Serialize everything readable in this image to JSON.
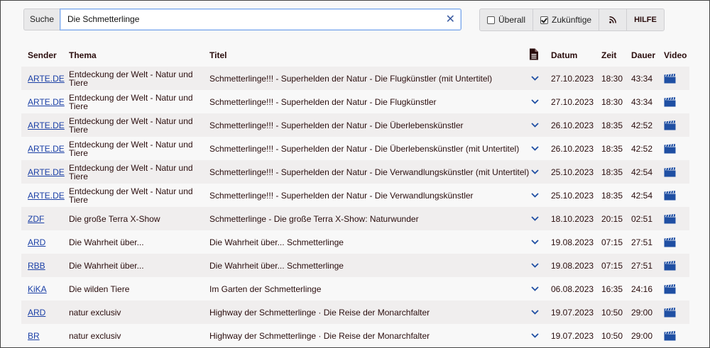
{
  "search": {
    "label": "Suche",
    "value": "Die Schmetterlinge",
    "clear_symbol": "✕"
  },
  "filters": {
    "everywhere_label": "Überall",
    "everywhere_checked": false,
    "future_label": "Zukünftige",
    "future_checked": true,
    "rss_icon": "rss-icon",
    "help_label": "HILFE"
  },
  "table": {
    "headers": {
      "sender": "Sender",
      "thema": "Thema",
      "titel": "Titel",
      "beschreibung_icon": "document-icon",
      "datum": "Datum",
      "zeit": "Zeit",
      "dauer": "Dauer",
      "video": "Video"
    },
    "rows": [
      {
        "sender": "ARTE.DE",
        "thema": "Entdeckung der Welt - Natur und Tiere",
        "titel": "Schmetterlinge!!! - Superhelden der Natur - Die Flugkünstler (mit Untertitel)",
        "datum": "27.10.2023",
        "zeit": "18:30",
        "dauer": "43:34"
      },
      {
        "sender": "ARTE.DE",
        "thema": "Entdeckung der Welt - Natur und Tiere",
        "titel": "Schmetterlinge!!! - Superhelden der Natur - Die Flugkünstler",
        "datum": "27.10.2023",
        "zeit": "18:30",
        "dauer": "43:34"
      },
      {
        "sender": "ARTE.DE",
        "thema": "Entdeckung der Welt - Natur und Tiere",
        "titel": "Schmetterlinge!!! - Superhelden der Natur - Die Überlebenskünstler",
        "datum": "26.10.2023",
        "zeit": "18:35",
        "dauer": "42:52"
      },
      {
        "sender": "ARTE.DE",
        "thema": "Entdeckung der Welt - Natur und Tiere",
        "titel": "Schmetterlinge!!! - Superhelden der Natur - Die Überlebenskünstler (mit Untertitel)",
        "datum": "26.10.2023",
        "zeit": "18:35",
        "dauer": "42:52"
      },
      {
        "sender": "ARTE.DE",
        "thema": "Entdeckung der Welt - Natur und Tiere",
        "titel": "Schmetterlinge!!! - Superhelden der Natur - Die Verwandlungskünstler (mit Untertitel)",
        "datum": "25.10.2023",
        "zeit": "18:35",
        "dauer": "42:54"
      },
      {
        "sender": "ARTE.DE",
        "thema": "Entdeckung der Welt - Natur und Tiere",
        "titel": "Schmetterlinge!!! - Superhelden der Natur - Die Verwandlungskünstler",
        "datum": "25.10.2023",
        "zeit": "18:35",
        "dauer": "42:54"
      },
      {
        "sender": "ZDF",
        "thema": "Die große Terra X-Show",
        "titel": "Schmetterlinge - Die große Terra X-Show: Naturwunder",
        "datum": "18.10.2023",
        "zeit": "20:15",
        "dauer": "02:51"
      },
      {
        "sender": "ARD",
        "thema": "Die Wahrheit über...",
        "titel": "Die Wahrheit über... Schmetterlinge",
        "datum": "19.08.2023",
        "zeit": "07:15",
        "dauer": "27:51"
      },
      {
        "sender": "RBB",
        "thema": "Die Wahrheit über...",
        "titel": "Die Wahrheit über... Schmetterlinge",
        "datum": "19.08.2023",
        "zeit": "07:15",
        "dauer": "27:51"
      },
      {
        "sender": "KiKA",
        "thema": "Die wilden Tiere",
        "titel": "Im Garten der Schmetterlinge",
        "datum": "06.08.2023",
        "zeit": "16:35",
        "dauer": "24:16"
      },
      {
        "sender": "ARD",
        "thema": "natur exclusiv",
        "titel": "Highway der Schmetterlinge · Die Reise der Monarchfalter",
        "datum": "19.07.2023",
        "zeit": "10:50",
        "dauer": "29:00"
      },
      {
        "sender": "BR",
        "thema": "natur exclusiv",
        "titel": "Highway der Schmetterlinge · Die Reise der Monarchfalter",
        "datum": "19.07.2023",
        "zeit": "10:50",
        "dauer": "29:00"
      }
    ]
  },
  "colors": {
    "link": "#1a3fa6",
    "text": "#2a0d0d",
    "icon_blue": "#1f4fa3",
    "row_alt": "#f0eeee",
    "focus_border": "#7aa7ea"
  }
}
